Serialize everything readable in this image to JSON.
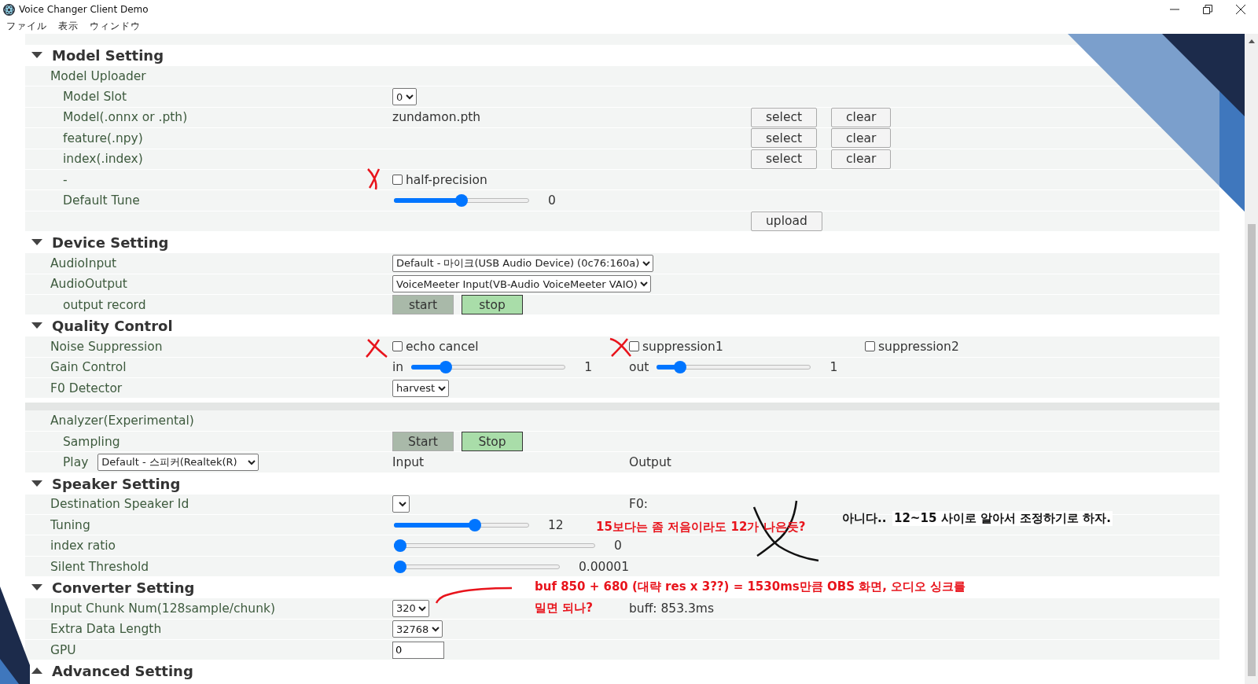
{
  "window": {
    "title": "Voice Changer Client Demo"
  },
  "menu": [
    "ファイル",
    "表示",
    "ウィンドウ"
  ],
  "sections": [
    {
      "title": "Model Setting",
      "expanded": true,
      "rows": [
        {
          "kind": "field",
          "label": "Model Uploader",
          "children": [
            {
              "kind": "field",
              "label": "Model Slot",
              "value": [
                {
                  "kind": "select",
                  "value": "0"
                }
              ]
            },
            {
              "kind": "field",
              "label": "Model(.onnx or .pth)",
              "value": [
                {
                  "kind": "text",
                  "text": "zundamon.pth"
                }
              ],
              "actions": [
                "select",
                "clear"
              ]
            },
            {
              "kind": "field",
              "label": "feature(.npy)",
              "actions": [
                "select",
                "clear"
              ]
            },
            {
              "kind": "field",
              "label": "index(.index)",
              "actions": [
                "select",
                "clear"
              ]
            },
            {
              "kind": "field",
              "label": "-",
              "value": [
                {
                  "kind": "checkbox",
                  "label": "half-precision",
                  "checked": false
                }
              ]
            },
            {
              "kind": "field",
              "label": "Default Tune",
              "value": [
                {
                  "kind": "slider",
                  "level": 0.5,
                  "reading": "0"
                }
              ]
            },
            {
              "kind": "field",
              "actions": [
                "upload"
              ]
            }
          ]
        }
      ]
    },
    {
      "title": "Device Setting",
      "expanded": true,
      "rows": [
        {
          "kind": "field",
          "label": "AudioInput",
          "value": [
            {
              "kind": "select",
              "value": "Default - 마이크(USB Audio Device) (0c76:160a)"
            }
          ]
        },
        {
          "kind": "field",
          "label": "AudioOutput",
          "value": [
            {
              "kind": "select",
              "value": "VoiceMeeter Input(VB-Audio VoiceMeeter VAIO)"
            }
          ],
          "children": [
            {
              "kind": "field",
              "label": "output record",
              "value": [
                {
                  "kind": "button",
                  "label": "start",
                  "on": false
                },
                {
                  "kind": "button",
                  "label": "stop",
                  "on": true
                }
              ]
            }
          ]
        }
      ]
    },
    {
      "title": "Quality Control",
      "expanded": true,
      "rows": [
        {
          "kind": "field",
          "label": "Noise Suppression",
          "value": [
            {
              "kind": "checkbox",
              "label": "echo cancel",
              "checked": false
            }
          ],
          "output": [
            {
              "kind": "checkbox",
              "label": "suppression1",
              "checked": false
            }
          ],
          "extra": [
            {
              "kind": "checkbox",
              "label": "suppression2",
              "checked": false
            }
          ]
        },
        {
          "kind": "field",
          "label": "Gain Control",
          "value": [
            {
              "kind": "text",
              "text": "in"
            },
            {
              "kind": "short_slider",
              "level": 0.2,
              "reading": "1"
            }
          ],
          "output": [
            {
              "kind": "text",
              "text": "out"
            },
            {
              "kind": "short_slider",
              "level": 0.12,
              "reading": "1"
            }
          ]
        },
        {
          "kind": "field",
          "label": "F0 Detector",
          "value": [
            {
              "kind": "select",
              "value": "harvest"
            }
          ]
        },
        {
          "kind": "band"
        },
        {
          "kind": "field",
          "label": "Analyzer(Experimental)",
          "children": [
            {
              "kind": "field",
              "label": "Sampling",
              "value": [
                {
                  "kind": "button",
                  "label": "Start",
                  "on": false
                },
                {
                  "kind": "button",
                  "label": "Stop",
                  "on": true
                }
              ]
            },
            {
              "kind": "field",
              "label": "Play",
              "label_select": "Default - 스피커(Realtek(R)",
              "value": [
                {
                  "kind": "text",
                  "text": "Input"
                }
              ],
              "output": [
                {
                  "kind": "text",
                  "text": "Output"
                }
              ]
            }
          ]
        }
      ]
    },
    {
      "title": "Speaker Setting",
      "expanded": true,
      "rows": [
        {
          "kind": "field",
          "label": "Destination Speaker Id",
          "value": [
            {
              "kind": "select"
            }
          ],
          "output": [
            {
              "kind": "text",
              "text": "F0:"
            }
          ]
        },
        {
          "kind": "field",
          "label": "Tuning",
          "value": [
            {
              "kind": "slider",
              "level": 0.61,
              "reading": "12"
            }
          ]
        },
        {
          "kind": "field",
          "label": "index ratio",
          "value": [
            {
              "kind": "long_slider",
              "level": 0,
              "reading": "0"
            }
          ]
        },
        {
          "kind": "field",
          "label": "Silent Threshold",
          "value": [
            {
              "kind": "long_slider",
              "level": 0,
              "reading": "0.00001"
            }
          ]
        }
      ]
    },
    {
      "title": "Converter Setting",
      "expanded": true,
      "rows": [
        {
          "kind": "field",
          "label": "Input Chunk Num(128sample/chunk)",
          "value": [
            {
              "kind": "select",
              "value": "320"
            }
          ],
          "output": [
            {
              "kind": "text",
              "text": "buff: 853.3ms"
            }
          ]
        },
        {
          "kind": "field",
          "label": "Extra Data Length",
          "value": [
            {
              "kind": "select",
              "value": "32768"
            }
          ]
        },
        {
          "kind": "field",
          "label": "GPU",
          "value": [
            {
              "kind": "input",
              "value": "0"
            }
          ]
        }
      ]
    },
    {
      "title": "Advanced Setting",
      "expanded": false
    }
  ],
  "annotations": [
    {
      "kind": "note",
      "text": "15보다는 좀 저음이라도 12가 나은듯?",
      "color": "#e8141c"
    },
    {
      "kind": "note",
      "text": "아니다..",
      "color": "#111111"
    },
    {
      "kind": "highlight",
      "text": "12~15 사이로 알아서 조정하기로 하자.",
      "color": "#111111"
    },
    {
      "kind": "note",
      "text": "buf 850 + 680 (대략 res x 3??) = 1530ms만큼 OBS 화면, 오디오 싱크를",
      "color": "#e8141c"
    },
    {
      "kind": "note",
      "text": "밀면 되나?",
      "color": "#e8141c"
    }
  ]
}
